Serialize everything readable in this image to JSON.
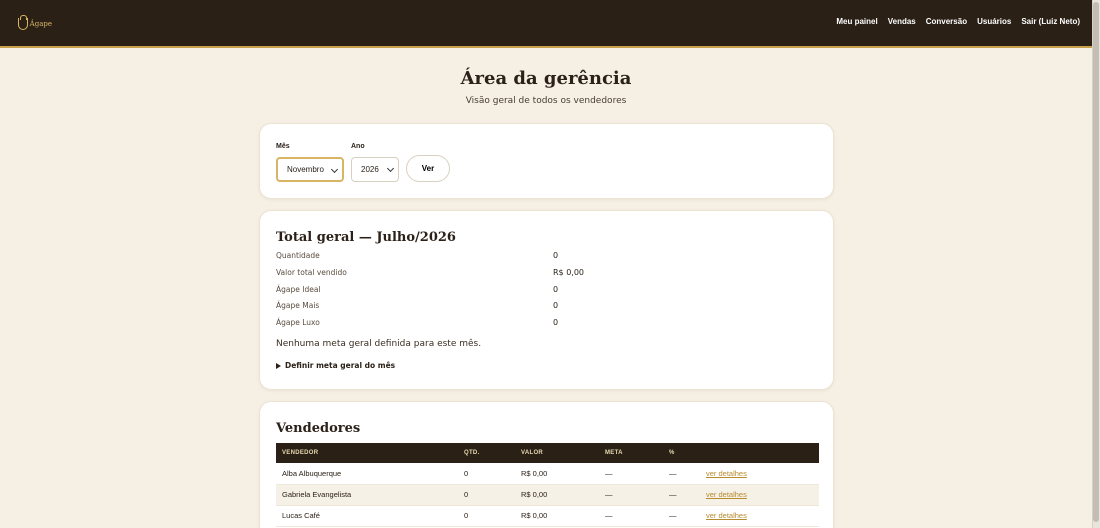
{
  "nav": {
    "logo_text": "Ágape",
    "items": [
      "Meu painel",
      "Vendas",
      "Conversão",
      "Usuários",
      "Sair (Luiz Neto)"
    ]
  },
  "hero": {
    "title": "Área da gerência",
    "subtitle": "Visão geral de todos os vendedores"
  },
  "filter": {
    "month_label": "Mês",
    "month_value": "Novembro",
    "year_label": "Ano",
    "year_value": "2026",
    "submit_label": "Ver"
  },
  "total": {
    "title": "Total geral — Julho/2026",
    "rows": [
      {
        "label": "Quantidade",
        "value": "0"
      },
      {
        "label": "Valor total vendido",
        "value": "R$ 0,00"
      },
      {
        "label": "Ágape Ideal",
        "value": "0"
      },
      {
        "label": "Ágape Mais",
        "value": "0"
      },
      {
        "label": "Ágape Luxo",
        "value": "0"
      }
    ],
    "no_goal_text": "Nenhuma meta geral definida para este mês.",
    "define_goal_label": "Definir meta geral do mês"
  },
  "sellers": {
    "title": "Vendedores",
    "columns": [
      "VENDEDOR",
      "QTD.",
      "VALOR",
      "META",
      "%",
      ""
    ],
    "rows": [
      {
        "name": "Alba Albuquerque",
        "qty": "0",
        "value": "R$ 0,00",
        "goal": "—",
        "pct": "—",
        "link": "ver detalhes"
      },
      {
        "name": "Gabriela Evangelista",
        "qty": "0",
        "value": "R$ 0,00",
        "goal": "—",
        "pct": "—",
        "link": "ver detalhes"
      },
      {
        "name": "Lucas Café",
        "qty": "0",
        "value": "R$ 0,00",
        "goal": "—",
        "pct": "—",
        "link": "ver detalhes"
      }
    ]
  },
  "colors": {
    "topbar": "#2a2016",
    "accent": "#d8b565",
    "background": "#f5efe4",
    "link": "#b68c2e"
  }
}
